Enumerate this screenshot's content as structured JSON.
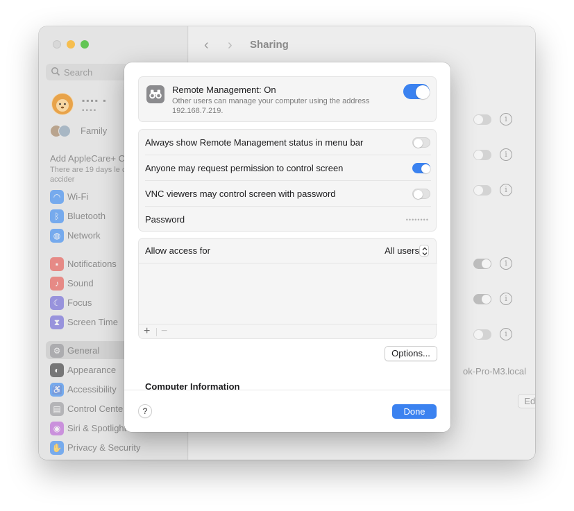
{
  "window": {
    "title": "Sharing",
    "nav": {
      "back": "‹",
      "forward": "›"
    }
  },
  "sidebar": {
    "search_placeholder": "Search",
    "account": {
      "name": "▪▪▪▪ ▪",
      "sub": "▪▪▪▪"
    },
    "family_label": "Family",
    "applecare": {
      "title": "Add AppleCare+ C",
      "desc": "There are 19 days le coverage for accider"
    },
    "items": [
      {
        "label": "Wi-Fi",
        "icon": "wifi-icon",
        "glyph": "◠",
        "color": "#1e7cf5"
      },
      {
        "label": "Bluetooth",
        "icon": "bluetooth-icon",
        "glyph": "ᛒ",
        "color": "#1e7cf5"
      },
      {
        "label": "Network",
        "icon": "network-icon",
        "glyph": "◍",
        "color": "#1e7cf5"
      },
      {
        "label": "Notifications",
        "icon": "notifications-icon",
        "glyph": "▪",
        "color": "#e8423a"
      },
      {
        "label": "Sound",
        "icon": "sound-icon",
        "glyph": "♪",
        "color": "#e8423a"
      },
      {
        "label": "Focus",
        "icon": "focus-icon",
        "glyph": "☾",
        "color": "#5b51d6"
      },
      {
        "label": "Screen Time",
        "icon": "screen-time-icon",
        "glyph": "⧗",
        "color": "#5b51d6"
      },
      {
        "label": "General",
        "icon": "general-icon",
        "glyph": "⚙",
        "color": "#8e8e93"
      },
      {
        "label": "Appearance",
        "icon": "appearance-icon",
        "glyph": "◐",
        "color": "#1d1d1f"
      },
      {
        "label": "Accessibility",
        "icon": "accessibility-icon",
        "glyph": "♿",
        "color": "#1e7cf5"
      },
      {
        "label": "Control Cente",
        "icon": "control-center-icon",
        "glyph": "▤",
        "color": "#8e8e93"
      },
      {
        "label": "Siri & Spotlight",
        "icon": "siri-icon",
        "glyph": "◉",
        "color": "#b64fd6"
      },
      {
        "label": "Privacy & Security",
        "icon": "privacy-icon",
        "glyph": "✋",
        "color": "#1e7cf5"
      }
    ]
  },
  "background": {
    "hostname": "ok-Pro-M3.local",
    "edit_label": "Edit...",
    "help_label": "?",
    "info_glyph": "i"
  },
  "dialog": {
    "remote_management": {
      "title": "Remote Management: On",
      "desc": "Other users can manage your computer using the address 192.168.7.219.",
      "enabled": true
    },
    "options": [
      {
        "label": "Always show Remote Management status in menu bar",
        "on": false
      },
      {
        "label": "Anyone may request permission to control screen",
        "on": true
      },
      {
        "label": "VNC viewers may control screen with password",
        "on": false
      }
    ],
    "password": {
      "label": "Password",
      "value": "••••••••"
    },
    "access": {
      "label": "Allow access for",
      "value": "All users",
      "add": "+",
      "remove": "−"
    },
    "options_button": "Options...",
    "computer_info_heading": "Computer Information",
    "help_button": "?",
    "done_button": "Done"
  },
  "colors": {
    "accent": "#3b82f0"
  }
}
